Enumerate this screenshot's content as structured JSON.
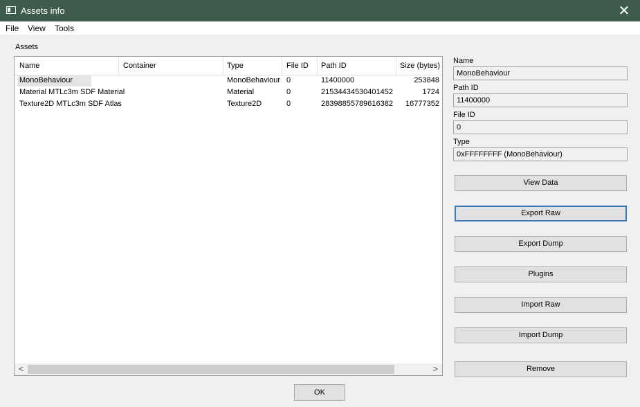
{
  "window": {
    "title": "Assets info",
    "close_glyph": "✕"
  },
  "menu": {
    "items": [
      "File",
      "View",
      "Tools"
    ]
  },
  "assets": {
    "group_label": "Assets",
    "columns": [
      "Name",
      "Container",
      "Type",
      "File ID",
      "Path ID",
      "Size (bytes)"
    ],
    "rows": [
      {
        "name": "MonoBehaviour",
        "container": "",
        "type": "MonoBehaviour",
        "file_id": "0",
        "path_id": "11400000",
        "size": "253848"
      },
      {
        "name": "Material MTLc3m SDF Material",
        "container": "",
        "type": "Material",
        "file_id": "0",
        "path_id": "21534434530401452",
        "size": "1724"
      },
      {
        "name": "Texture2D MTLc3m SDF Atlas",
        "container": "",
        "type": "Texture2D",
        "file_id": "0",
        "path_id": "28398855789616382",
        "size": "16777352"
      }
    ],
    "scroll_left": "<",
    "scroll_right": ">"
  },
  "details": {
    "name_label": "Name",
    "name_value": "MonoBehaviour",
    "path_id_label": "Path ID",
    "path_id_value": "11400000",
    "file_id_label": "File ID",
    "file_id_value": "0",
    "type_label": "Type",
    "type_value": "0xFFFFFFFF (MonoBehaviour)"
  },
  "buttons": {
    "view_data": "View Data",
    "export_raw": "Export Raw",
    "export_dump": "Export Dump",
    "plugins": "Plugins",
    "import_raw": "Import Raw",
    "import_dump": "Import Dump",
    "remove": "Remove",
    "ok": "OK"
  }
}
